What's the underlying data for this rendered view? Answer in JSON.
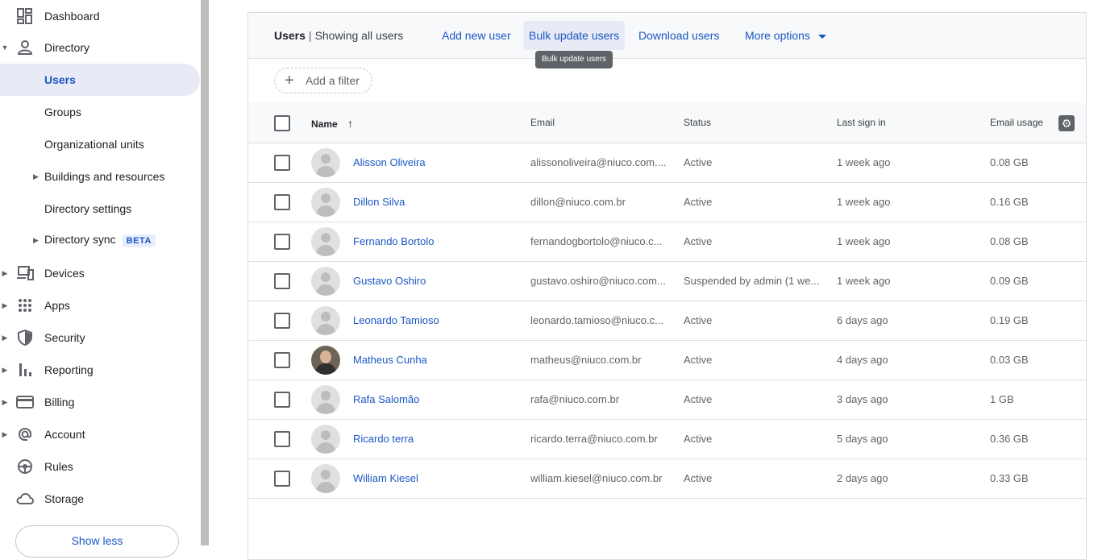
{
  "sidebar": {
    "items": [
      {
        "label": "Dashboard",
        "icon": "dashboard-icon"
      },
      {
        "label": "Directory",
        "icon": "person-icon"
      },
      {
        "label": "Users"
      },
      {
        "label": "Groups"
      },
      {
        "label": "Organizational units"
      },
      {
        "label": "Buildings and resources"
      },
      {
        "label": "Directory settings"
      },
      {
        "label": "Directory sync",
        "badge": "BETA"
      },
      {
        "label": "Devices",
        "icon": "devices-icon"
      },
      {
        "label": "Apps",
        "icon": "apps-grid-icon"
      },
      {
        "label": "Security",
        "icon": "shield-icon"
      },
      {
        "label": "Reporting",
        "icon": "bar-chart-icon"
      },
      {
        "label": "Billing",
        "icon": "credit-card-icon"
      },
      {
        "label": "Account",
        "icon": "at-sign-icon"
      },
      {
        "label": "Rules",
        "icon": "rules-icon"
      },
      {
        "label": "Storage",
        "icon": "cloud-icon"
      }
    ],
    "show_less": "Show less"
  },
  "header": {
    "title": "Users",
    "separator": "|",
    "subtitle": "Showing all users",
    "actions": {
      "add": "Add new user",
      "bulk": "Bulk update users",
      "download": "Download users",
      "more": "More options"
    },
    "tooltip": "Bulk update users"
  },
  "filter": {
    "label": "Add a filter"
  },
  "table": {
    "columns": {
      "name": "Name",
      "email": "Email",
      "status": "Status",
      "last_sign_in": "Last sign in",
      "email_usage": "Email usage"
    },
    "rows": [
      {
        "name": "Alisson Oliveira",
        "email": "alissonoliveira@niuco.com....",
        "status": "Active",
        "last": "1 week ago",
        "usage": "0.08 GB"
      },
      {
        "name": "Dillon Silva",
        "email": "dillon@niuco.com.br",
        "status": "Active",
        "last": "1 week ago",
        "usage": "0.16 GB"
      },
      {
        "name": "Fernando Bortolo",
        "email": "fernandogbortolo@niuco.c...",
        "status": "Active",
        "last": "1 week ago",
        "usage": "0.08 GB"
      },
      {
        "name": "Gustavo Oshiro",
        "email": "gustavo.oshiro@niuco.com...",
        "status": "Suspended by admin (1 we...",
        "last": "1 week ago",
        "usage": "0.09 GB"
      },
      {
        "name": "Leonardo Tamioso",
        "email": "leonardo.tamioso@niuco.c...",
        "status": "Active",
        "last": "6 days ago",
        "usage": "0.19 GB"
      },
      {
        "name": "Matheus Cunha",
        "email": "matheus@niuco.com.br",
        "status": "Active",
        "last": "4 days ago",
        "usage": "0.03 GB"
      },
      {
        "name": "Rafa Salomão",
        "email": "rafa@niuco.com.br",
        "status": "Active",
        "last": "3 days ago",
        "usage": "1 GB"
      },
      {
        "name": "Ricardo terra",
        "email": "ricardo.terra@niuco.com.br",
        "status": "Active",
        "last": "5 days ago",
        "usage": "0.36 GB"
      },
      {
        "name": "William Kiesel",
        "email": "william.kiesel@niuco.com.br",
        "status": "Active",
        "last": "2 days ago",
        "usage": "0.33 GB"
      }
    ]
  },
  "colors": {
    "accent": "#1a56c4",
    "selected_bg": "#e8eaf6"
  }
}
